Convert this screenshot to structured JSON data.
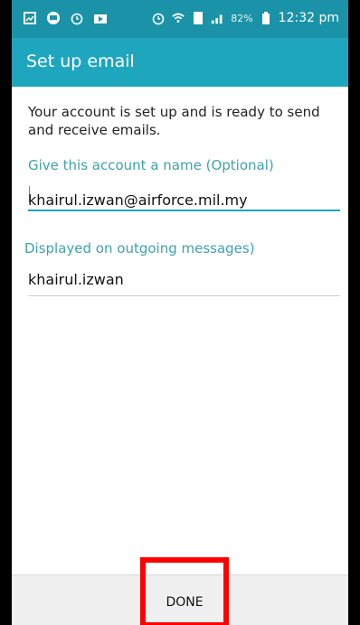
{
  "status_bar": {
    "left_icons": [
      "gallery-icon",
      "messenger-icon",
      "alarm-icon",
      "video-icon"
    ],
    "right_icons": [
      "alarm-icon",
      "wifi-icon",
      "sim-icon",
      "signal-icon"
    ],
    "battery": "82%",
    "time": "12:32 pm"
  },
  "app_bar": {
    "title": "Set up email"
  },
  "content": {
    "intro_text": "Your account is set up and is ready to send and receive emails.",
    "account_name_label": "Give this account a name (Optional)",
    "account_name_value": "khairul.izwan@airforce.mil.my",
    "display_name_label": "Displayed on outgoing messages)",
    "display_name_value": "khairul.izwan"
  },
  "bottom_bar": {
    "done_label": "DONE"
  },
  "colors": {
    "statusbar": "#1a93a8",
    "appbar": "#1ea6bf",
    "label_teal": "#3fa1b2",
    "highlight": "#ff0000"
  }
}
